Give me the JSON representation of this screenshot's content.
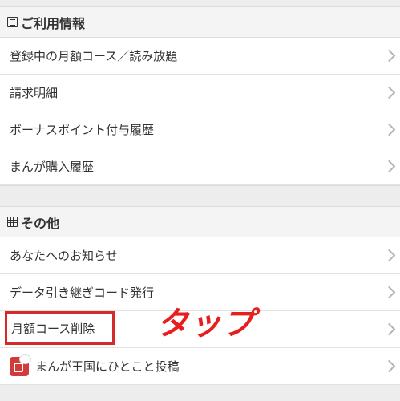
{
  "sections": [
    {
      "header": "ご利用情報",
      "icon": "list-icon",
      "items": [
        {
          "label": "登録中の月額コース／読み放題"
        },
        {
          "label": "請求明細"
        },
        {
          "label": "ボーナスポイント付与履歴"
        },
        {
          "label": "まんが購入履歴"
        }
      ]
    },
    {
      "header": "その他",
      "icon": "grid-icon",
      "items": [
        {
          "label": "あなたへのお知らせ"
        },
        {
          "label": "データ引き継ぎコード発行"
        },
        {
          "label": "月額コース削除"
        },
        {
          "label": "まんが王国にひとこと投稿"
        }
      ]
    }
  ],
  "annotation": {
    "text": "タップ",
    "color": "#e61e1e"
  },
  "colors": {
    "highlight_box": "#d42a2a",
    "chevron": "#b5b5b5",
    "app_icon": "#d33a3a"
  }
}
